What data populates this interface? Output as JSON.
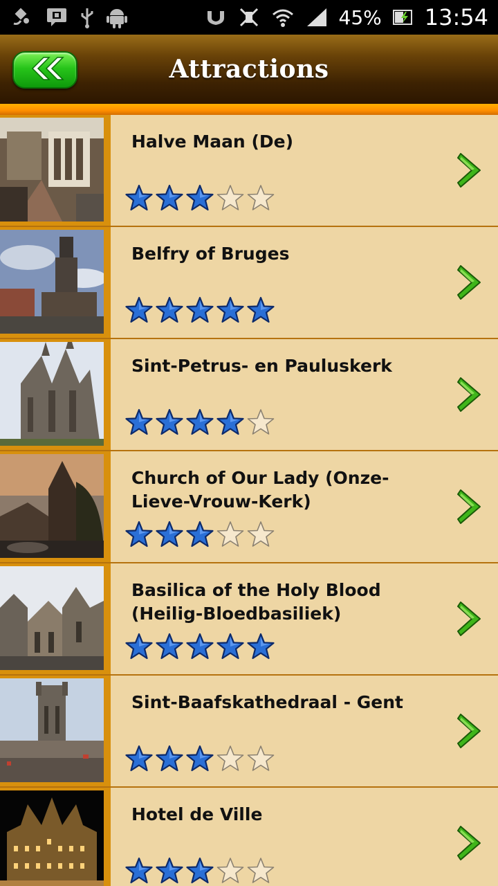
{
  "status_bar": {
    "left_icons": [
      "satellite-icon",
      "message-icon",
      "usb-icon",
      "android-icon"
    ],
    "right_icons": [
      "nfc-icon",
      "vibrate-off-icon",
      "wifi-icon",
      "signal-icon"
    ],
    "battery": "45%",
    "time": "13:54"
  },
  "header": {
    "title": "Attractions",
    "back_icon": "double-chevron-left-icon",
    "accent": "#1fb81a"
  },
  "colors": {
    "row_bg": "#eed6a4",
    "header_dark": "#2c1600",
    "orange": "#ff9a00",
    "star_filled": "#2a6fd6",
    "star_empty": "#ffffff",
    "chevron": "#3fb51a"
  },
  "attractions": [
    {
      "name": "Halve Maan (De)",
      "rating": 3,
      "max_rating": 5,
      "thumb": "brewery-interior"
    },
    {
      "name": "Belfry of Bruges",
      "rating": 5,
      "max_rating": 5,
      "thumb": "belfry-tower"
    },
    {
      "name": "Sint-Petrus- en Pauluskerk",
      "rating": 4,
      "max_rating": 5,
      "thumb": "gothic-church"
    },
    {
      "name": "Church of Our Lady (Onze-Lieve-Vrouw-Kerk)",
      "rating": 3,
      "max_rating": 5,
      "thumb": "church-sunset"
    },
    {
      "name": "Basilica of the Holy Blood (Heilig-Bloedbasiliek)",
      "rating": 5,
      "max_rating": 5,
      "thumb": "basilica-square"
    },
    {
      "name": "Sint-Baafskathedraal - Gent",
      "rating": 3,
      "max_rating": 5,
      "thumb": "cathedral-tower"
    },
    {
      "name": "Hotel de Ville",
      "rating": 3,
      "max_rating": 5,
      "thumb": "city-hall-night"
    }
  ]
}
